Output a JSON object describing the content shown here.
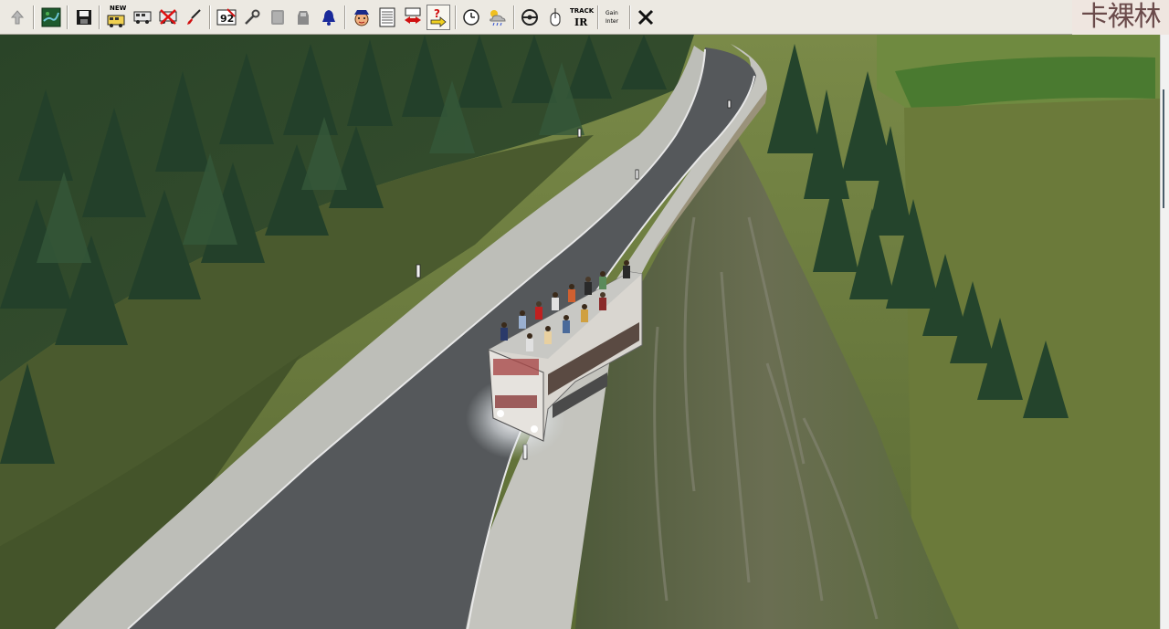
{
  "toolbar": {
    "buttons": [
      {
        "name": "up-arrow-button",
        "icon": "up-arrow-icon"
      },
      {
        "name": "map-button",
        "icon": "map-icon"
      },
      {
        "name": "save-button",
        "icon": "floppy-disk-icon"
      },
      {
        "name": "new-vehicle-button",
        "icon": "new-bus-icon",
        "label": "NEW"
      },
      {
        "name": "edit-vehicle-button",
        "icon": "bus-icon"
      },
      {
        "name": "delete-vehicle-button",
        "icon": "bus-delete-icon"
      },
      {
        "name": "paint-button",
        "icon": "brush-icon"
      },
      {
        "name": "route-number-button",
        "icon": "route-number-icon",
        "label": "92"
      },
      {
        "name": "tools-button",
        "icon": "wrench-icon"
      },
      {
        "name": "sign-button",
        "icon": "sign-icon"
      },
      {
        "name": "stop-button",
        "icon": "stop-icon"
      },
      {
        "name": "bell-button",
        "icon": "bell-icon"
      },
      {
        "name": "driver-button",
        "icon": "driver-face-icon"
      },
      {
        "name": "timetable-button",
        "icon": "timetable-icon"
      },
      {
        "name": "swap-button",
        "icon": "swap-arrows-icon"
      },
      {
        "name": "help-button",
        "icon": "help-arrow-icon"
      },
      {
        "name": "clock-button",
        "icon": "clock-icon"
      },
      {
        "name": "weather-button",
        "icon": "weather-icon"
      },
      {
        "name": "steering-button",
        "icon": "steering-wheel-icon"
      },
      {
        "name": "mouse-button",
        "icon": "mouse-icon"
      },
      {
        "name": "track-button",
        "icon": "track-ir-icon",
        "label": "TRACK",
        "label2": "IR"
      },
      {
        "name": "options-button",
        "icon": "options-icon",
        "label": "Gain",
        "label2": "Inter"
      },
      {
        "name": "close-button",
        "icon": "close-icon"
      }
    ]
  },
  "watermark": {
    "text": "卡裸林"
  },
  "scene": {
    "description_icon": "game-viewport",
    "colors": {
      "sky": "#8a9a5a",
      "forest": "#2f4a2a",
      "road": "#55575a",
      "sidewalk": "#bfc0bc",
      "cliff": "#5c6448",
      "meadow": "#6a7a3c"
    }
  }
}
